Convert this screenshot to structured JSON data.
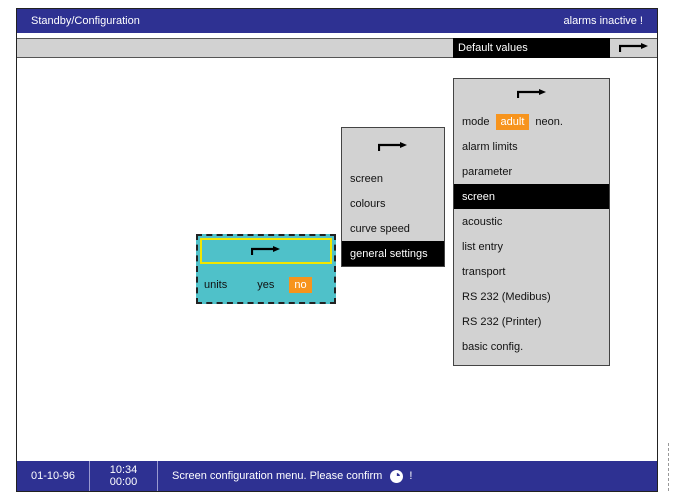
{
  "titlebar": {
    "title": "Standby/Configuration",
    "alarm_status": "alarms inactive !"
  },
  "subbar": {
    "default_values_label": "Default values",
    "arrow_icon": "return-arrow-icon"
  },
  "right_menu": {
    "arrow_icon": "return-arrow-icon",
    "mode": {
      "label": "mode",
      "selected": "adult",
      "other": "neon."
    },
    "items": [
      {
        "label": "alarm limits"
      },
      {
        "label": "parameter"
      },
      {
        "label": "screen",
        "selected": true
      },
      {
        "label": "acoustic"
      },
      {
        "label": "list entry"
      },
      {
        "label": "transport"
      },
      {
        "label": "RS 232 (Medibus)"
      },
      {
        "label": "RS 232 (Printer)"
      },
      {
        "label": "basic config."
      }
    ]
  },
  "middle_menu": {
    "arrow_icon": "return-arrow-icon",
    "items": [
      {
        "label": "screen"
      },
      {
        "label": "colours"
      },
      {
        "label": "curve speed"
      },
      {
        "label": "general settings",
        "selected": true
      }
    ]
  },
  "units_box": {
    "arrow_icon": "return-arrow-icon",
    "label": "units",
    "yes": "yes",
    "no": "no",
    "selected": "no"
  },
  "statusbar": {
    "date": "01-10-96",
    "time": "10:34",
    "elapsed": "00:00",
    "message": "Screen configuration menu. Please confirm",
    "message_suffix": "!",
    "confirm_icon": "rotary-knob-icon"
  },
  "colors": {
    "bar_blue": "#2e3192",
    "menu_gray": "#d2d2d2",
    "highlight_orange": "#f7941d",
    "teal": "#4fc1c9",
    "yellow_border": "#f2e600"
  }
}
